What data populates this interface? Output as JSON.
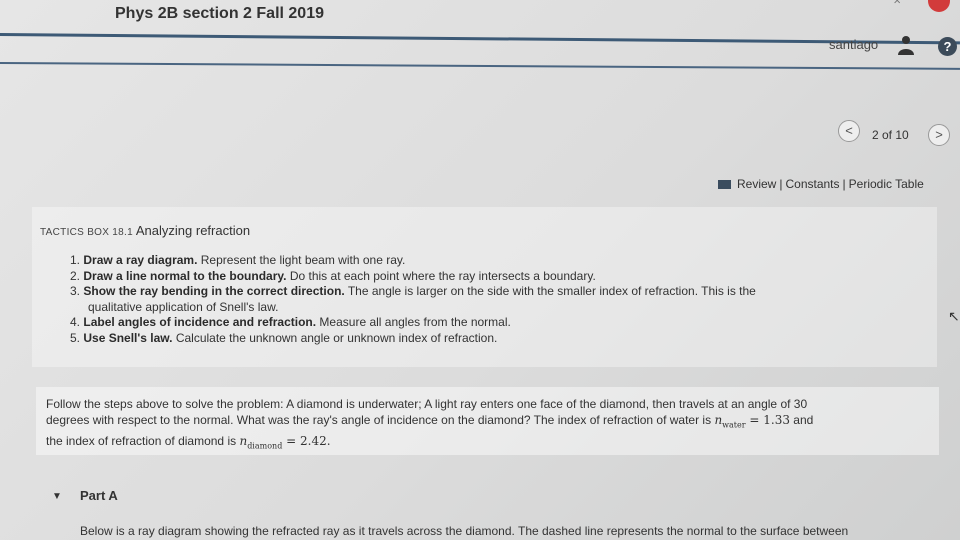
{
  "header": {
    "course_title": "Phys 2B section 2 Fall 2019",
    "user_name": "santiago",
    "help_label": "?"
  },
  "pager": {
    "prev_label": "<",
    "next_label": ">",
    "position_label": "2 of 10"
  },
  "resource_links": {
    "review": "Review",
    "constants": "Constants",
    "periodic_table": "Periodic Table",
    "separator": "|"
  },
  "tactics": {
    "prefix": "TACTICS BOX 18.1",
    "title": "Analyzing refraction",
    "steps": [
      {
        "num": "1.",
        "bold": "Draw a ray diagram.",
        "text": " Represent the light beam with one ray."
      },
      {
        "num": "2.",
        "bold": "Draw a line normal to the boundary.",
        "text": " Do this at each point where the  ray intersects a boundary."
      },
      {
        "num": "3.",
        "bold": "Show the ray bending in the correct direction.",
        "text": " The angle is larger on  the side with the smaller index of refraction. This is the",
        "cont": "qualitative application  of Snell's law."
      },
      {
        "num": "4.",
        "bold": "Label angles of incidence and refraction.",
        "text": " Measure all angles from the  normal."
      },
      {
        "num": "5.",
        "bold": "Use Snell's law.",
        "text": " Calculate the unknown angle or unknown index of  refraction."
      }
    ]
  },
  "problem": {
    "line1": "Follow the steps above to solve the problem: A diamond is underwater; A light ray enters one face of the diamond,  then travels at an angle of 30",
    "line2": "degrees with respect to the normal.  What was the ray's angle of incidence on the diamond? The index of refraction of water is ",
    "n_water_sym": "n",
    "n_water_sub": "water",
    "n_water_val": " = 1.33",
    "line2_end": "  and",
    "line3": "the index of refraction of diamond is ",
    "n_diamond_sym": "n",
    "n_diamond_sub": "diamond",
    "n_diamond_val": " = 2.42."
  },
  "part": {
    "toggle": "▼",
    "label": "Part A",
    "text": "Below is a ray diagram showing the refracted ray as it travels across the diamond. The dashed line represents the normal to the surface between"
  }
}
